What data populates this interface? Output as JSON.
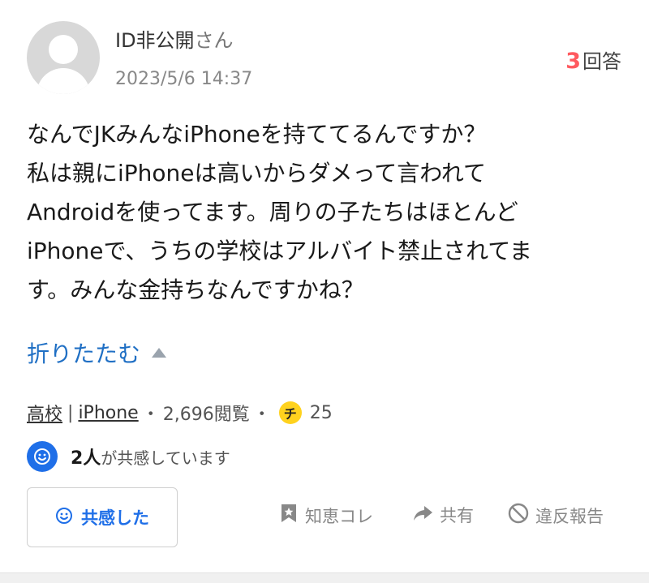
{
  "user": {
    "name": "ID非公開",
    "suffix": "さん",
    "date": "2023/5/6 14:37"
  },
  "answers": {
    "count": "3",
    "label": "回答"
  },
  "question": {
    "lines": [
      "なんでJKみんなiPhoneを持ててるんですか？",
      "私は親にiPhoneは高いからダメって言われて",
      "Androidを使ってます。周りの子たちはほとんど",
      "iPhoneで、うちの学校はアルバイト禁止されてま",
      "す。みんな金持ちなんですかね？"
    ]
  },
  "collapse": {
    "label": "折りたたむ"
  },
  "meta": {
    "tag1": "高校",
    "separator": "|",
    "tag2": "iPhone",
    "dot": "・",
    "views": "2,696閲覧",
    "coin_glyph": "チ",
    "coins": "25"
  },
  "empathy": {
    "count": "2人",
    "text": "が共感しています",
    "button_label": "共感した"
  },
  "actions": {
    "chiekore": "知恵コレ",
    "share": "共有",
    "report": "違反報告"
  },
  "colors": {
    "accent_blue": "#1f6fe8",
    "link_blue": "#1f6fc4",
    "answer_red": "#ff5a5f",
    "coin_yellow": "#ffd21e"
  },
  "icons": [
    "avatar-placeholder",
    "caret-up-icon",
    "coin-icon",
    "smile-icon",
    "bookmark-icon",
    "share-arrow-icon",
    "prohibited-icon"
  ]
}
